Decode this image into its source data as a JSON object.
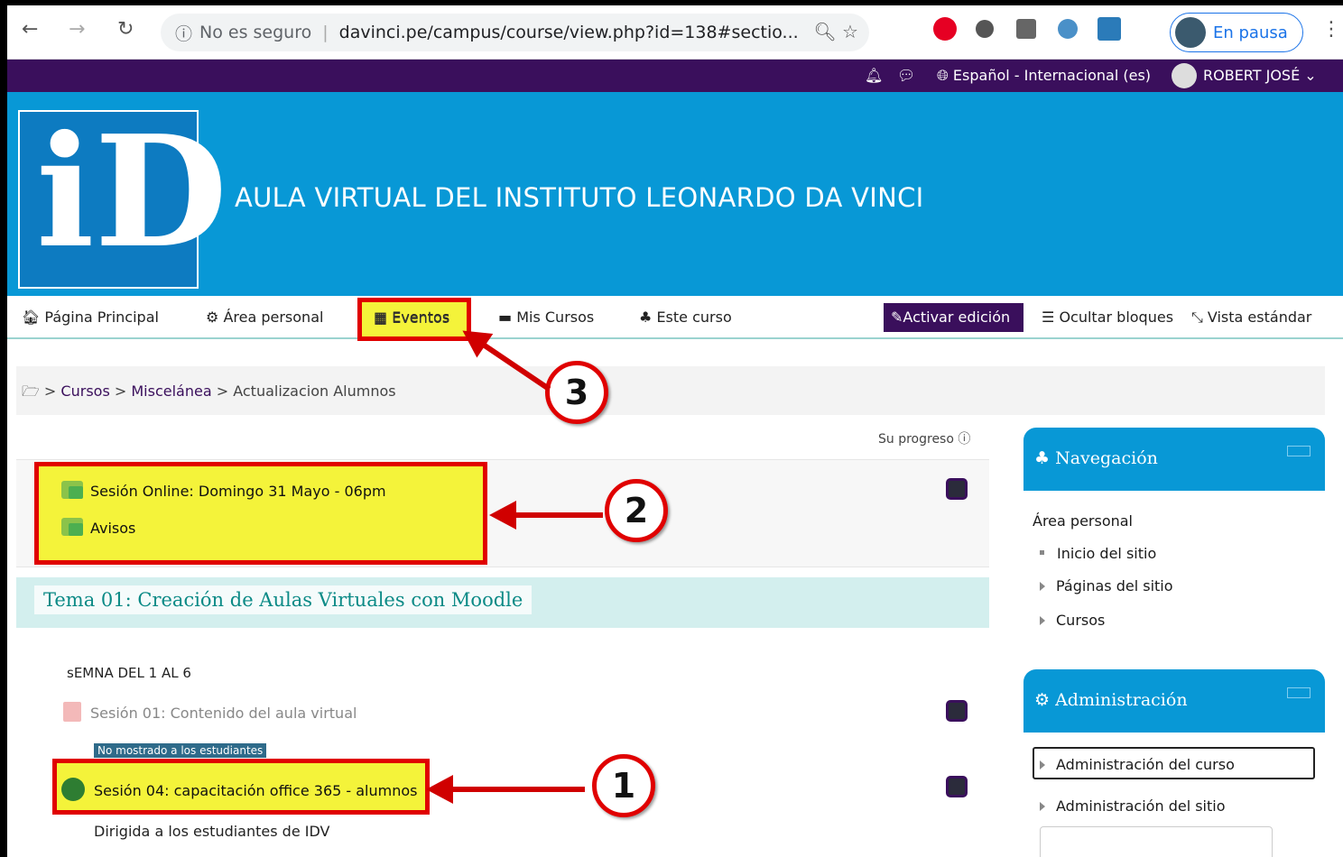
{
  "browser": {
    "url_security": "No es seguro",
    "url": "davinci.pe/campus/course/view.php?id=138#sectio...",
    "profile_label": "En pausa"
  },
  "topbar": {
    "language": "Español - Internacional (es)",
    "user": "ROBERT JOSÉ"
  },
  "header": {
    "title": "AULA VIRTUAL DEL INSTITUTO LEONARDO DA VINCI"
  },
  "nav": {
    "home": "Página Principal",
    "personal": "Área personal",
    "events": "Eventos",
    "mycourses": "Mis Cursos",
    "thiscourse": "Este curso",
    "edit": "Activar edición",
    "hide": "Ocultar bloques",
    "standard": "Vista estándar"
  },
  "breadcrumb": {
    "cursos": "Cursos",
    "misc": "Miscelánea",
    "current": "Actualizacion Alumnos"
  },
  "main": {
    "progress": "Su progreso",
    "section0": [
      "Sesión Online: Domingo 31 Mayo - 06pm",
      "Avisos"
    ],
    "section1_title": "Tema 01: Creación de Aulas Virtuales con Moodle",
    "week": "sEMNA DEL 1 AL 6",
    "session01": "Sesión 01: Contenido del aula virtual",
    "badge": "No mostrado a los estudiantes",
    "session04": "Sesión 04: capacitación office 365 - alumnos",
    "session04_desc": "Dirigida a los estudiantes de IDV"
  },
  "annotations": [
    "1",
    "2",
    "3"
  ],
  "blocks": {
    "navegacion": {
      "title": "Navegación",
      "items": [
        "Área personal",
        "Inicio del sitio",
        "Páginas del sitio",
        "Cursos"
      ]
    },
    "administracion": {
      "title": "Administración",
      "items": [
        "Administración del curso",
        "Administración del sitio"
      ]
    }
  },
  "colors": {
    "purple": "#3a0f5c",
    "blue": "#0898d6",
    "highlight": "#f4f33a",
    "red": "#e00000"
  }
}
